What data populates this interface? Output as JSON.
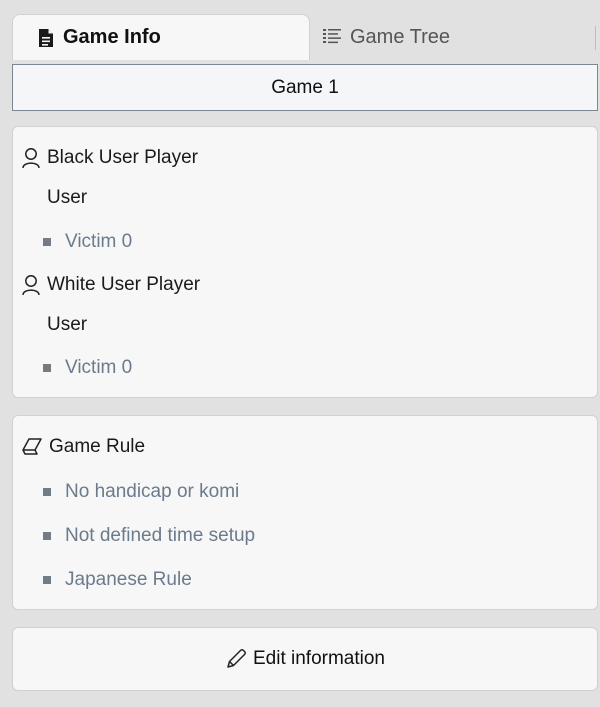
{
  "tabs": {
    "game_info": {
      "label": "Game Info",
      "icon": "document-icon"
    },
    "game_tree": {
      "label": "Game Tree",
      "icon": "list-tree-icon"
    }
  },
  "game_selector": {
    "label": "Game 1"
  },
  "players": {
    "black": {
      "title": "Black User Player",
      "type": "User",
      "victim": "Victim 0",
      "icon": "user-icon"
    },
    "white": {
      "title": "White User Player",
      "type": "User",
      "victim": "Victim 0",
      "icon": "user-icon"
    }
  },
  "rules": {
    "title": "Game Rule",
    "icon": "eraser-icon",
    "items": [
      "No handicap or komi",
      "Not defined time setup",
      "Japanese Rule"
    ]
  },
  "edit_button": {
    "label": "Edit information",
    "icon": "pencil-icon"
  }
}
